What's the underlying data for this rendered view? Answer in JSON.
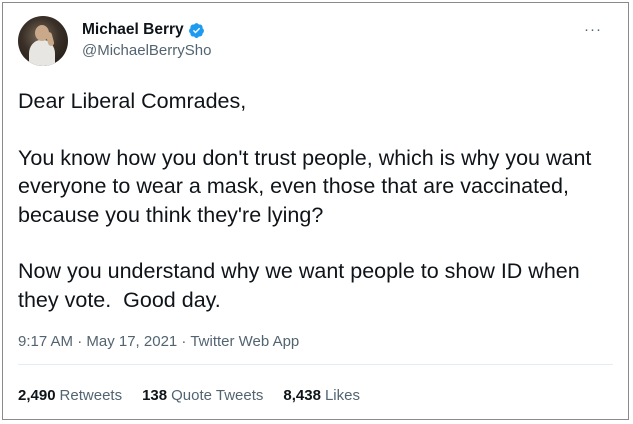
{
  "user": {
    "display_name": "Michael Berry",
    "handle": "@MichaelBerrySho",
    "verified": true
  },
  "more_label": "···",
  "tweet": {
    "paragraphs": [
      "Dear Liberal Comrades,",
      "You know how you don't trust people, which is why you want everyone to wear a mask, even those that are vaccinated, because you think they're lying?",
      "Now you understand why we want people to show ID when they vote.  Good day."
    ]
  },
  "meta": {
    "text": "9:17 AM · May 17, 2021 · Twitter Web App"
  },
  "stats": [
    {
      "count": "2,490",
      "label": "Retweets"
    },
    {
      "count": "138",
      "label": "Quote Tweets"
    },
    {
      "count": "8,438",
      "label": "Likes"
    }
  ],
  "colors": {
    "verified_badge": "#1d9bf0",
    "secondary_text": "#536471",
    "primary_text": "#0f1419"
  },
  "icons": {
    "verified": "verified-badge-icon",
    "more": "more-options-icon"
  }
}
